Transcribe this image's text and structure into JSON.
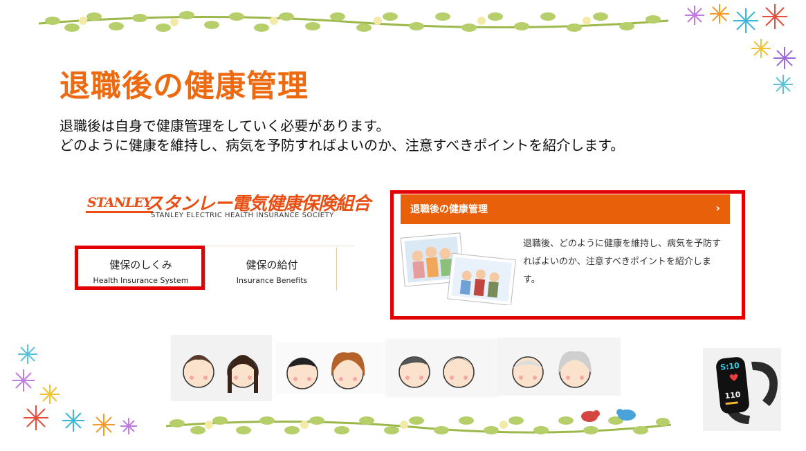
{
  "page": {
    "title": "退職後の健康管理",
    "intro_line1": "退職後は自身で健康管理をしていく必要があります。",
    "intro_line2": "どのように健康を維持し、病気を予防すればよいのか、注意すべきポイントを紹介します。"
  },
  "logo": {
    "mark": "STANLEY",
    "jp": "スタンレー電気健康保険組合",
    "en": "STANLEY ELECTRIC HEALTH INSURANCE SOCIETY"
  },
  "tabs": [
    {
      "jp": "健保のしくみ",
      "en": "Health Insurance System"
    },
    {
      "jp": "健保の給付",
      "en": "Insurance Benefits"
    }
  ],
  "card": {
    "header": "退職後の健康管理",
    "chevron": "›",
    "body": "退職後、どのように健康を維持し、病気を予防すればよいのか、注意すべきポイントを紹介します。"
  },
  "watch": {
    "display_top": "S:10",
    "display_bottom": "110"
  },
  "colors": {
    "accent": "#ee6a11",
    "card_header": "#e8600a",
    "highlight": "#e30000",
    "logo": "#e94e12"
  }
}
